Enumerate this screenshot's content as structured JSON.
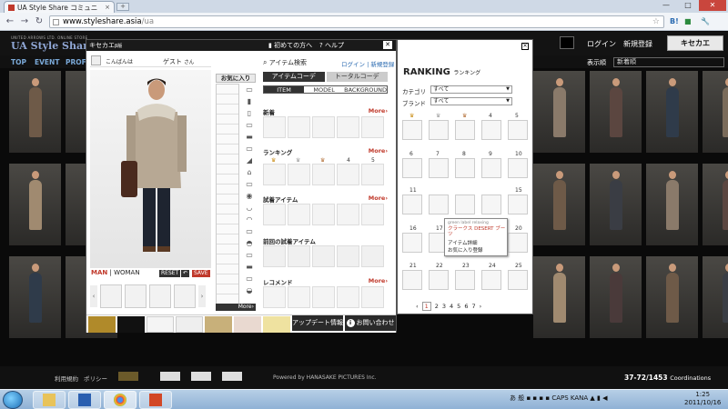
{
  "browser": {
    "tab_title": "UA Style Share コミュニ",
    "url_host": "www.styleshare.asia",
    "url_path": "/ua",
    "window_buttons": [
      "—",
      "□",
      "✕"
    ]
  },
  "site": {
    "logo_small": "UNITED ARROWS LTD. ONLINE STORE",
    "logo": "UA Style Share",
    "login": "ログイン",
    "register": "新規登録",
    "kisekae_button": "キセカエ",
    "nav": [
      "TOP",
      "EVENT",
      "PROF"
    ],
    "sort_label": "表示順",
    "sort_value": "新着順"
  },
  "kisekae": {
    "title": "キセカエ",
    "title_sub": "β版",
    "first_time": "初めての方へ",
    "help": "ヘルプ",
    "close": "✕",
    "greeting": "こんばんは",
    "guest": "ゲスト",
    "guest_suffix": "さん",
    "favorites_header": "お気に入り",
    "man": "MAN",
    "woman": "WOMAN",
    "separator": "|",
    "reset": "RESET",
    "undo": "↶",
    "save": "SAVE",
    "more": "More›",
    "update_info": "アップデート情報",
    "contact": "お問い合わせ",
    "item_search": "アイテム検索",
    "login": "ログイン",
    "register": "新規登録",
    "tab_item_coord": "アイテムコーデ",
    "tab_total_coord": "トータルコーデ",
    "subtab_item": "ITEM",
    "subtab_model": "MODEL",
    "subtab_background": "BACKGROUND",
    "sections": [
      {
        "title": "新着",
        "more": "More›"
      },
      {
        "title": "ランキング",
        "more": "More›",
        "ranks": [
          "4",
          "5"
        ]
      },
      {
        "title": "試着アイテム",
        "more": "More›"
      },
      {
        "title": "前回の試着アイテム",
        "more": ""
      },
      {
        "title": "レコメンド",
        "more": "More›"
      }
    ]
  },
  "ranking": {
    "close": "✕",
    "title": "RANKING",
    "title_sub": "ランキング",
    "category_label": "カテゴリ",
    "category_value": "すべて",
    "brand_label": "ブランド",
    "brand_value": "すべて",
    "numbers": [
      "4",
      "5",
      "6",
      "7",
      "8",
      "9",
      "10",
      "11",
      "15",
      "16",
      "17",
      "18",
      "19",
      "20",
      "21",
      "22",
      "23",
      "24",
      "25"
    ],
    "tooltip": {
      "brand": "green label relaxing",
      "name": "クラークス DESERT ブーツ",
      "detail": "アイテム詳細",
      "add_fav": "お気に入り登録"
    },
    "pager": [
      "‹",
      "1",
      "2",
      "3",
      "4",
      "5",
      "6",
      "7",
      "›"
    ]
  },
  "footer": {
    "terms": "利用規約",
    "policy": "ポリシー",
    "powered": "Powered by HANASAKE PICTURES Inc.",
    "coords_count": "37-72/1453",
    "coords_label": "Coordinations"
  },
  "taskbar": {
    "clock_time": "1:25",
    "clock_date": "2011/10/16",
    "ime": "あ 般",
    "lang": "CAPS KANA"
  }
}
